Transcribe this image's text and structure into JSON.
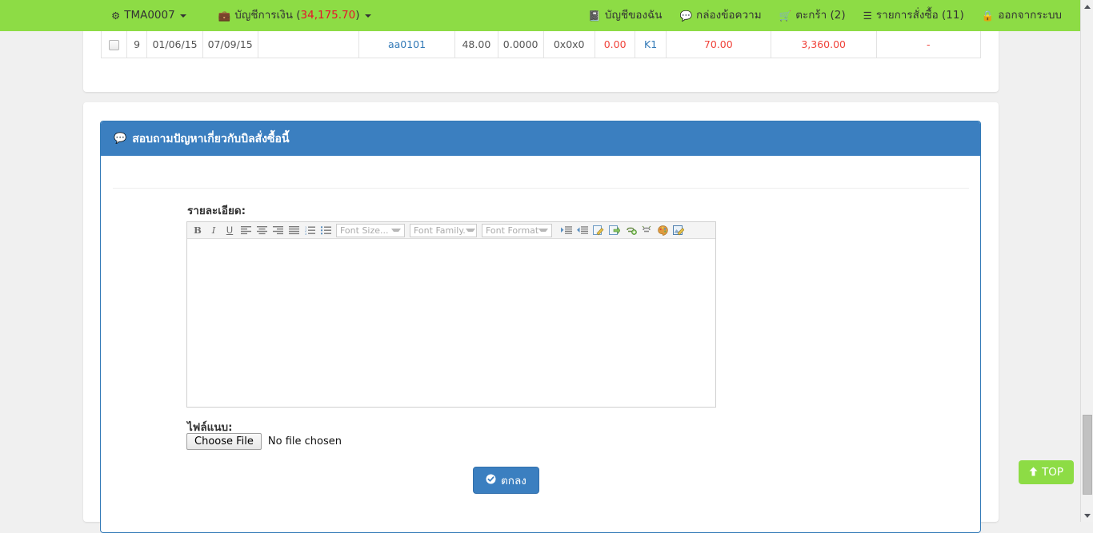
{
  "navbar": {
    "background": "#8ddc45",
    "left_items": [
      {
        "icon": "gear-icon",
        "glyph": "⚙",
        "label": "TMA0007",
        "caret": true
      },
      {
        "icon": "briefcase-icon",
        "glyph": "💼",
        "label_prefix": "บัญชีการเงิน (",
        "amount": "34,175.70",
        "label_suffix": ")",
        "caret": true,
        "amount_color": "#e8112d"
      }
    ],
    "right_items": [
      {
        "icon": "book-icon",
        "glyph": "📓",
        "label": "บัญชีของฉัน"
      },
      {
        "icon": "comment-icon",
        "glyph": "💬",
        "label": "กล่องข้อความ"
      },
      {
        "icon": "cart-icon",
        "glyph": "🛒",
        "label": "ตะกร้า (2)"
      },
      {
        "icon": "list-icon",
        "glyph": "☰",
        "label": "รายการสั่งซื้อ (11)"
      },
      {
        "icon": "lock-icon",
        "glyph": "🔒",
        "label": "ออกจากระบบ"
      }
    ]
  },
  "order_table": {
    "row": {
      "checkbox_checked": false,
      "no": "9",
      "date_start": "01/06/15",
      "date_end": "07/09/15",
      "blank": "",
      "code": "aa0101",
      "qty": "48.00",
      "rate": "0.0000",
      "size": "0x0x0",
      "discount": "0.00",
      "type": "K1",
      "price": "70.00",
      "total": "3,360.00",
      "note": "-"
    },
    "colors": {
      "link": "#337ab7",
      "amount": "#f0433a"
    }
  },
  "question_panel": {
    "header_icon": "comment-icon",
    "header_glyph": "💬",
    "header_title": "สอบถามปัญหาเกี่ยวกับบิลสั่งซื้อนี้",
    "header_color": "#3b7fc0",
    "detail_label": "รายละเอียด:",
    "attachment_label": "ไฟล์แนบ:",
    "editor": {
      "content": "",
      "toolbar_buttons": [
        {
          "name": "bold-icon",
          "glyph": "B",
          "style": "b"
        },
        {
          "name": "italic-icon",
          "glyph": "I",
          "style": "i"
        },
        {
          "name": "underline-icon",
          "glyph": "U",
          "style": "u"
        },
        {
          "name": "align-left-icon",
          "glyph": "≡",
          "style": "al"
        },
        {
          "name": "align-center-icon",
          "glyph": "≡",
          "style": "ac"
        },
        {
          "name": "align-right-icon",
          "glyph": "≡",
          "style": "ar"
        },
        {
          "name": "align-justify-icon",
          "glyph": "≡",
          "style": "aj"
        },
        {
          "name": "ordered-list-icon",
          "glyph": "☰",
          "style": "ol"
        },
        {
          "name": "unordered-list-icon",
          "glyph": "☰",
          "style": "ul"
        }
      ],
      "selects": [
        {
          "name": "font-size-select",
          "label": "Font Size..."
        },
        {
          "name": "font-family-select",
          "label": "Font Family."
        },
        {
          "name": "font-format-select",
          "label": "Font Format"
        }
      ],
      "toolbar_buttons_2": [
        {
          "name": "outdent-icon",
          "glyph": "≡"
        },
        {
          "name": "indent-icon",
          "glyph": "≡"
        },
        {
          "name": "edit-source-icon",
          "glyph": "✎"
        },
        {
          "name": "insert-template-icon",
          "glyph": "⬇"
        },
        {
          "name": "insert-link-icon",
          "glyph": "🔗"
        },
        {
          "name": "unlink-icon",
          "glyph": "🔗"
        },
        {
          "name": "text-color-icon",
          "glyph": "🎨"
        },
        {
          "name": "insert-image-icon",
          "glyph": "🖼"
        }
      ]
    },
    "file_input": {
      "button_label": "Choose File",
      "status_text": "No file chosen"
    },
    "submit_button": {
      "label": "ตกลง",
      "icon": "check-circle-icon",
      "glyph": "✔",
      "color": "#3b7fc0"
    }
  },
  "top_button": {
    "label": "TOP",
    "icon": "arrow-up-icon",
    "glyph": "↑",
    "color": "#8ddc45"
  },
  "scrollbar": {
    "up_arrow": "scroll-up-arrow",
    "down_arrow": "scroll-down-arrow",
    "thumb": "scroll-thumb"
  }
}
